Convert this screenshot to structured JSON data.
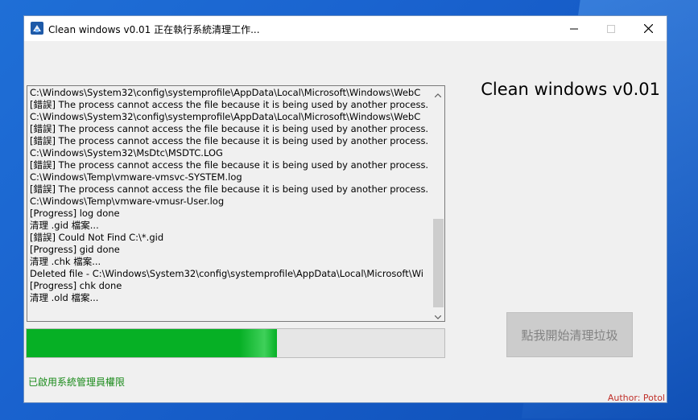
{
  "window": {
    "title": "Clean windows v0.01 正在執行系統清理工作...",
    "controls": {
      "minimize": "minimize-icon",
      "maximize": "maximize-icon",
      "close": "close-icon"
    }
  },
  "log": {
    "lines": [
      "C:\\Windows\\System32\\config\\systemprofile\\AppData\\Local\\Microsoft\\Windows\\WebC",
      "[錯誤] The process cannot access the file because it is being used by another process.",
      "C:\\Windows\\System32\\config\\systemprofile\\AppData\\Local\\Microsoft\\Windows\\WebC",
      "[錯誤] The process cannot access the file because it is being used by another process.",
      "[錯誤] The process cannot access the file because it is being used by another process.",
      "C:\\Windows\\System32\\MsDtc\\MSDTC.LOG",
      "[錯誤] The process cannot access the file because it is being used by another process.",
      "C:\\Windows\\Temp\\vmware-vmsvc-SYSTEM.log",
      "[錯誤] The process cannot access the file because it is being used by another process.",
      "C:\\Windows\\Temp\\vmware-vmusr-User.log",
      "[Progress] log done",
      "清理 .gid 檔案...",
      "[錯誤] Could Not Find C:\\*.gid",
      "[Progress] gid done",
      "清理 .chk 檔案...",
      "Deleted file - C:\\Windows\\System32\\config\\systemprofile\\AppData\\Local\\Microsoft\\Wi",
      "[Progress] chk done",
      "清理 .old 檔案..."
    ]
  },
  "progress": {
    "value": 0.6,
    "color": "#06b025"
  },
  "app_heading": "Clean windows v0.01",
  "start_button": {
    "label": "點我開始清理垃圾",
    "enabled": false
  },
  "status_text": "已啟用系統管理員權限",
  "author": "Author: Potol",
  "colors": {
    "status": "#1a8a1a",
    "author": "#c0302a",
    "accent": "#1f6fd6"
  }
}
